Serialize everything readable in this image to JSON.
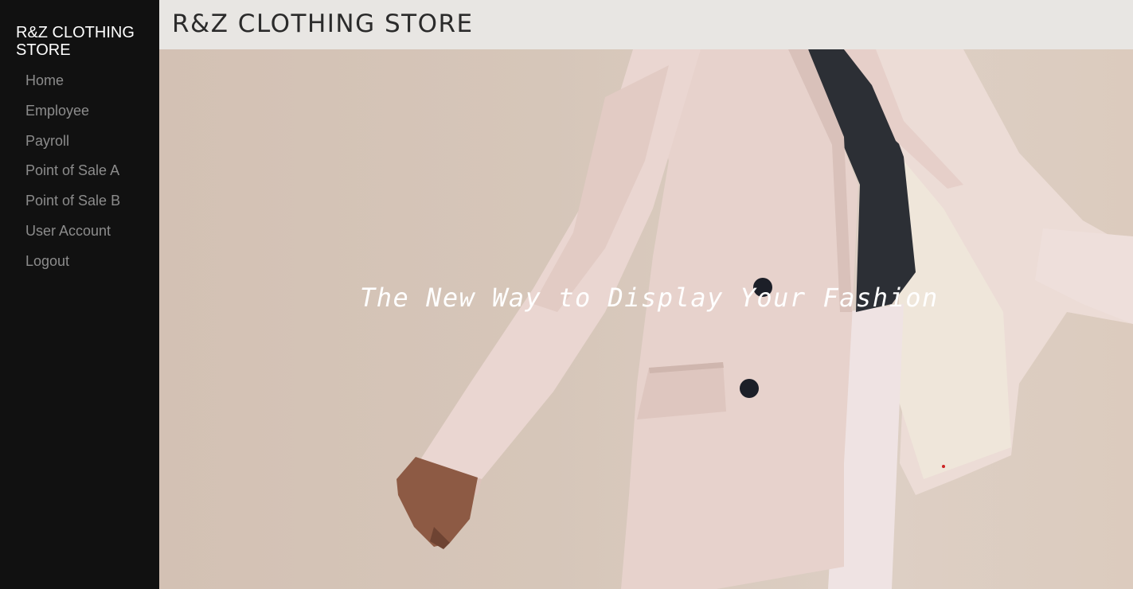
{
  "sidebar": {
    "brand": "R&Z CLOTHING STORE",
    "items": [
      {
        "label": "Home"
      },
      {
        "label": "Employee"
      },
      {
        "label": "Payroll"
      },
      {
        "label": "Point of Sale A"
      },
      {
        "label": "Point of Sale B"
      },
      {
        "label": "User Account"
      },
      {
        "label": "Logout"
      }
    ]
  },
  "header": {
    "title": "R&Z CLOTHING STORE"
  },
  "hero": {
    "caption": "The New Way to Display Your Fashion",
    "image": "model-in-pink-blazer-photo"
  },
  "colors": {
    "sidebar_bg": "#111111",
    "sidebar_text": "#8c8c8c",
    "brand_text": "#ffffff",
    "topbar_bg": "#e8e6e3",
    "title_text": "#2b2b2b",
    "caption_text": "#ffffff"
  }
}
